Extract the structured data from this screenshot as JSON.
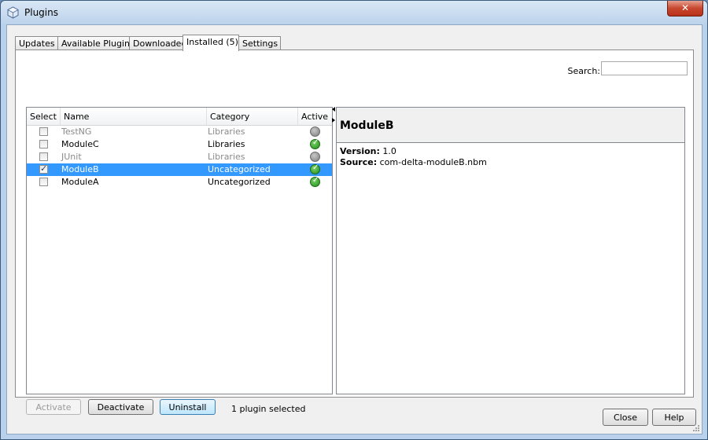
{
  "window": {
    "title": "Plugins",
    "close_glyph": "✕"
  },
  "tabs": [
    {
      "label": "Updates"
    },
    {
      "label": "Available Plugins"
    },
    {
      "label": "Downloaded"
    },
    {
      "label": "Installed (5)"
    },
    {
      "label": "Settings"
    }
  ],
  "active_tab": "Installed (5)",
  "search": {
    "label": "Search:",
    "value": ""
  },
  "table": {
    "columns": [
      "Select",
      "Name",
      "Category",
      "Active"
    ],
    "rows": [
      {
        "name": "TestNG",
        "category": "Libraries",
        "checked": false,
        "active": false
      },
      {
        "name": "ModuleC",
        "category": "Libraries",
        "checked": false,
        "active": true
      },
      {
        "name": "JUnit",
        "category": "Libraries",
        "checked": false,
        "active": false
      },
      {
        "name": "ModuleB",
        "category": "Uncategorized",
        "checked": true,
        "active": true
      },
      {
        "name": "ModuleA",
        "category": "Uncategorized",
        "checked": false,
        "active": true
      }
    ]
  },
  "details": {
    "title": "ModuleB",
    "version_label": "Version:",
    "version_value": " 1.0",
    "source_label": "Source:",
    "source_value": " com-delta-moduleB.nbm"
  },
  "actions": {
    "activate_label": "Activate",
    "deactivate_label": "Deactivate",
    "uninstall_label": "Uninstall",
    "status": "1 plugin selected"
  },
  "footer": {
    "close_label": "Close",
    "help_label": "Help"
  },
  "colors": {
    "selection": "#3399ff",
    "active_green": "#1f8c1a",
    "inactive_gray": "#7d7d7d"
  },
  "icons": {
    "app": "plugin-cube-icon",
    "active": "checkmark-circle-icon",
    "inactive": "gray-circle-icon"
  }
}
